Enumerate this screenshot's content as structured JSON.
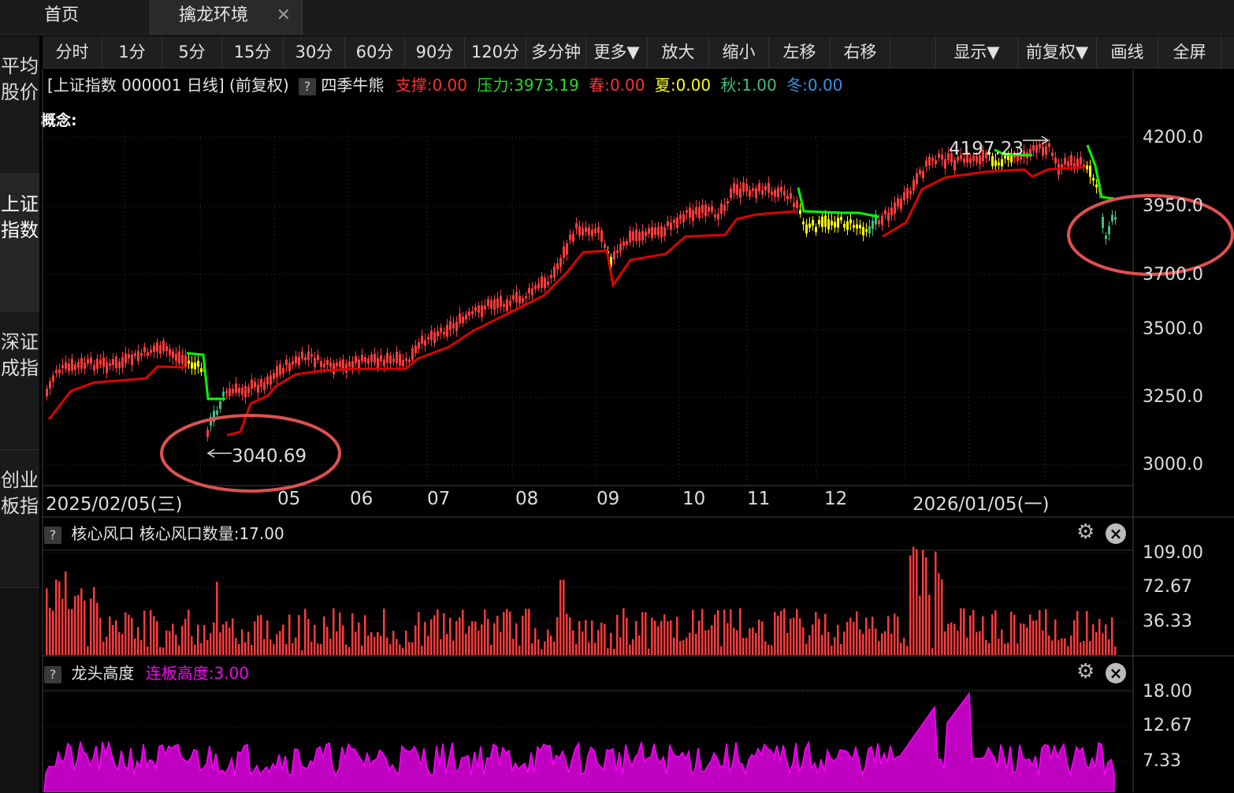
{
  "tabs": {
    "home": "首页",
    "active": "擒龙环境",
    "close": "✕"
  },
  "sidebar": [
    "平均股价",
    "上证指数",
    "深证成指",
    "创业板指"
  ],
  "toolbar": [
    {
      "label": "分时",
      "x": 54,
      "w": 76
    },
    {
      "label": "1分",
      "x": 130,
      "w": 76
    },
    {
      "label": "5分",
      "x": 206,
      "w": 76
    },
    {
      "label": "15分",
      "x": 282,
      "w": 78
    },
    {
      "label": "30分",
      "x": 360,
      "w": 78
    },
    {
      "label": "60分",
      "x": 438,
      "w": 76
    },
    {
      "label": "90分",
      "x": 514,
      "w": 76
    },
    {
      "label": "120分",
      "x": 590,
      "w": 78
    },
    {
      "label": "多分钟",
      "x": 668,
      "w": 76
    },
    {
      "label": "更多▼",
      "x": 744,
      "w": 78
    },
    {
      "label": "放大",
      "x": 822,
      "w": 78
    },
    {
      "label": "缩小",
      "x": 900,
      "w": 76
    },
    {
      "label": "左移",
      "x": 976,
      "w": 78
    },
    {
      "label": "右移",
      "x": 1054,
      "w": 76
    },
    {
      "label": "",
      "x": 1130,
      "w": 58
    },
    {
      "label": "显示▼",
      "x": 1188,
      "w": 104
    },
    {
      "label": "前复权▼",
      "x": 1292,
      "w": 100
    },
    {
      "label": "画线",
      "x": 1392,
      "w": 78
    },
    {
      "label": "全屏",
      "x": 1470,
      "w": 80
    }
  ],
  "info": {
    "title": "[上证指数 000001 日线]  (前复权)",
    "q": "?",
    "indicator": "四季牛熊",
    "support_label": "支撑:",
    "support_value": "0.00",
    "pressure_label": "压力:",
    "pressure_value": "3973.19",
    "spring_label": "春:",
    "spring_value": "0.00",
    "summer_label": "夏:",
    "summer_value": "0.00",
    "autumn_label": "秋:",
    "autumn_value": "1.00",
    "winter_label": "冬:",
    "winter_value": "0.00",
    "concept": "概念:"
  },
  "main_chart": {
    "y_ticks": [
      "4200.0",
      "3950.0",
      "3700.0",
      "3500.0",
      "3250.0",
      "3000.0"
    ],
    "x_ticks": [
      "2025/02/05(三)",
      "05",
      "06",
      "07",
      "08",
      "09",
      "10",
      "11",
      "12",
      "2026/01/05(一)"
    ],
    "high_label": "4197.23",
    "low_label": "3040.69",
    "colors": {
      "up": "#ff3b3b",
      "down": "#3fbf7f",
      "yellow": "#ffff00",
      "green": "#00ff00",
      "line": "#e00000",
      "annotation": "#e05050"
    }
  },
  "panel1": {
    "q": "?",
    "title": "核心风口  核心风口数量:17.00",
    "y_ticks": [
      "109.00",
      "72.67",
      "36.33"
    ]
  },
  "panel2": {
    "q": "?",
    "title": "龙头高度",
    "value_label": "连板高度:3.00",
    "y_ticks": [
      "18.00",
      "12.67",
      "7.33"
    ],
    "color": "#ff00ff"
  }
}
